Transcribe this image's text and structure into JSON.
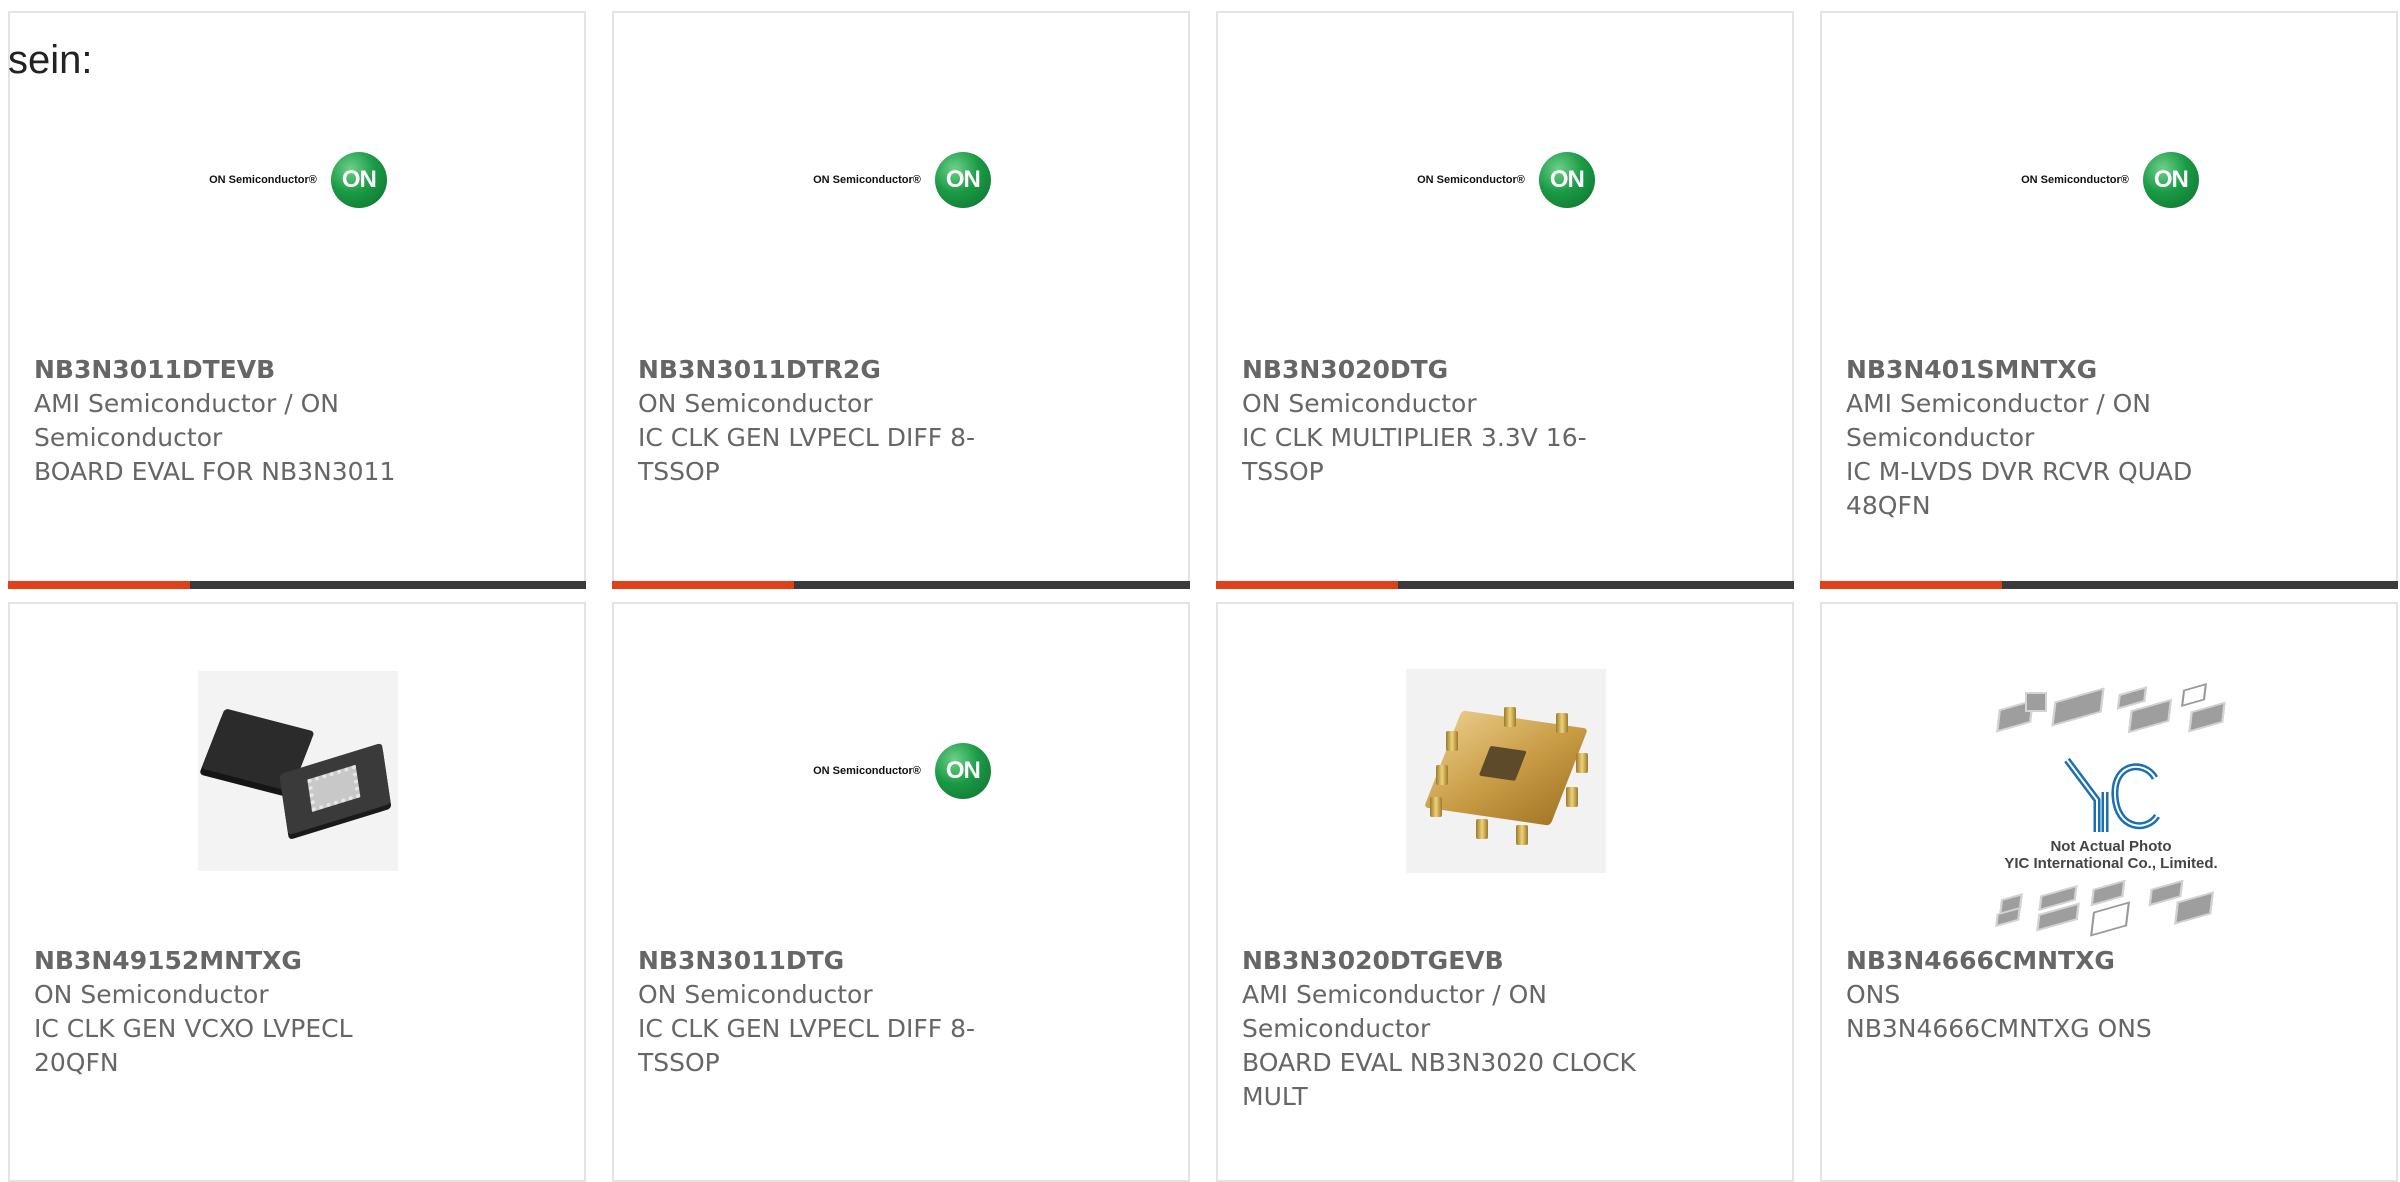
{
  "page": {
    "lead_text": "sein:"
  },
  "colors": {
    "accent": "#e0411a",
    "bar": "#3b3b3b",
    "border": "#e3e3e3",
    "text": "#666666",
    "on_logo_green": "#1a9a45"
  },
  "logo": {
    "on_word": "ON Semiconductor",
    "on_trademark": "®",
    "on_circle": "ON"
  },
  "placeholder_photo": {
    "brand": "YIC",
    "line1": "Not Actual Photo",
    "line2": "YIC International Co., Limited."
  },
  "products": [
    {
      "part_number": "NB3N3011DTEVB",
      "manufacturer": "AMI Semiconductor / ON Semiconductor",
      "description": "BOARD EVAL FOR NB3N3011",
      "image": "on-semiconductor-logo"
    },
    {
      "part_number": "NB3N3011DTR2G",
      "manufacturer": "ON Semiconductor",
      "description": "IC CLK GEN LVPECL DIFF 8-TSSOP",
      "image": "on-semiconductor-logo"
    },
    {
      "part_number": "NB3N3020DTG",
      "manufacturer": "ON Semiconductor",
      "description": "IC CLK MULTIPLIER 3.3V 16-TSSOP",
      "image": "on-semiconductor-logo"
    },
    {
      "part_number": "NB3N401SMNTXG",
      "manufacturer": "AMI Semiconductor / ON Semiconductor",
      "description": "IC M-LVDS DVR RCVR QUAD 48QFN",
      "image": "on-semiconductor-logo"
    },
    {
      "part_number": "NB3N49152MNTXG",
      "manufacturer": "ON Semiconductor",
      "description": "IC CLK GEN VCXO LVPECL 20QFN",
      "image": "qfn-chip-photo"
    },
    {
      "part_number": "NB3N3011DTG",
      "manufacturer": "ON Semiconductor",
      "description": "IC CLK GEN LVPECL DIFF 8-TSSOP",
      "image": "on-semiconductor-logo"
    },
    {
      "part_number": "NB3N3020DTGEVB",
      "manufacturer": "AMI Semiconductor / ON Semiconductor",
      "description": "BOARD EVAL NB3N3020 CLOCK MULT",
      "image": "evaluation-board-photo"
    },
    {
      "part_number": "NB3N4666CMNTXG",
      "manufacturer": "ONS",
      "description": "NB3N4666CMNTXG ONS",
      "image": "not-actual-photo"
    }
  ]
}
